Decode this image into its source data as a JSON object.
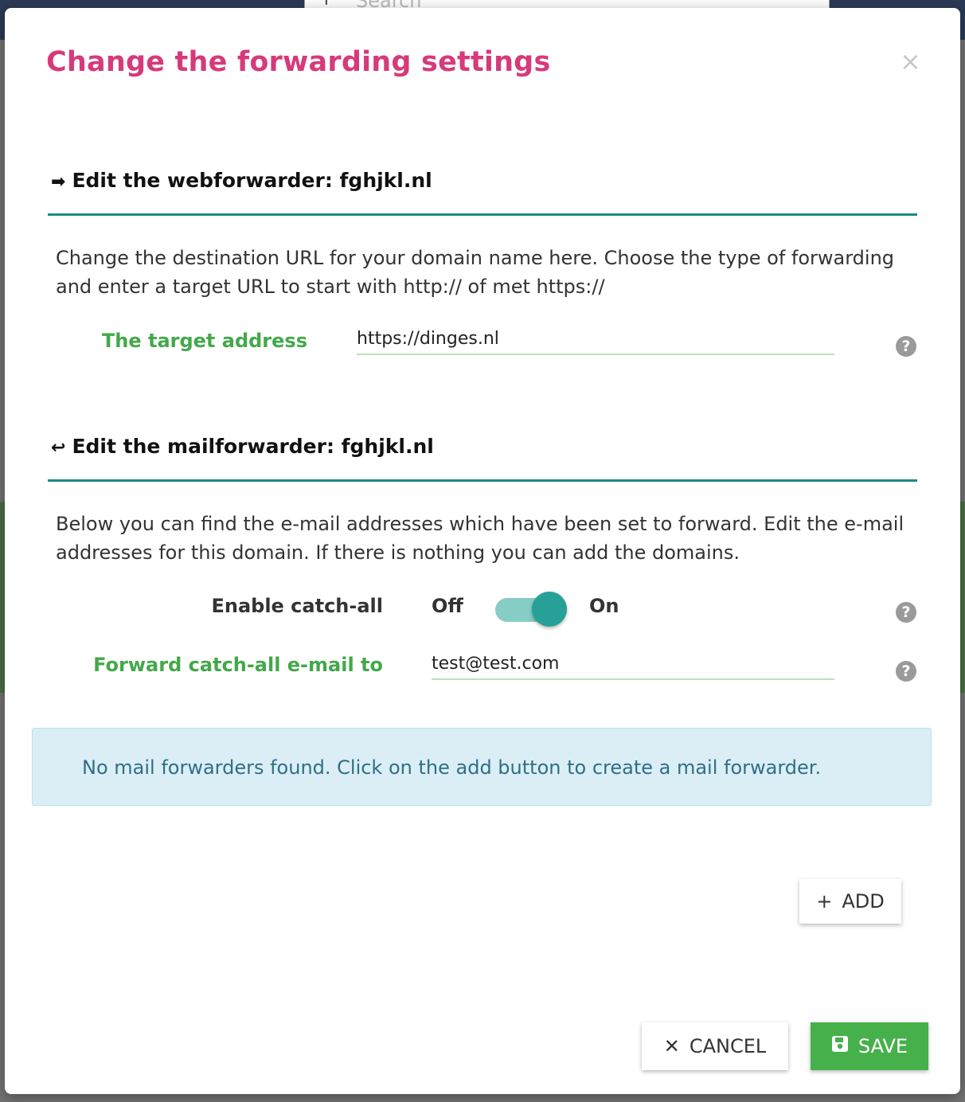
{
  "background": {
    "search_placeholder": "Search"
  },
  "modal": {
    "title": "Change the forwarding settings",
    "close_icon": "×"
  },
  "webforwarder": {
    "heading": "Edit the webforwarder: fghjkl.nl",
    "description": "Change the destination URL for your domain name here. Choose the type of forwarding and enter a target URL to start with http:// of met https://",
    "target_label": "The target address",
    "target_value": "https://dinges.nl"
  },
  "mailforwarder": {
    "heading": "Edit the mailforwarder: fghjkl.nl",
    "description": "Below you can find the e-mail addresses which have been set to forward. Edit the e-mail addresses for this domain. If there is nothing you can add the domains.",
    "catchall_label": "Enable catch-all",
    "toggle_off": "Off",
    "toggle_on": "On",
    "catchall_enabled": true,
    "forward_label": "Forward catch-all e-mail to",
    "forward_value": "test@test.com",
    "empty_notice": "No mail forwarders found. Click on the add button to create a mail forwarder."
  },
  "buttons": {
    "add": "ADD",
    "cancel": "CANCEL",
    "save": "SAVE"
  },
  "icons": {
    "help": "?",
    "plus": "+",
    "x": "✕"
  },
  "colors": {
    "title": "#d63a7a",
    "accent_teal": "#1a8a85",
    "label_green": "#43a84a",
    "save_green": "#46b04a",
    "info_bg": "#dbeef6"
  }
}
